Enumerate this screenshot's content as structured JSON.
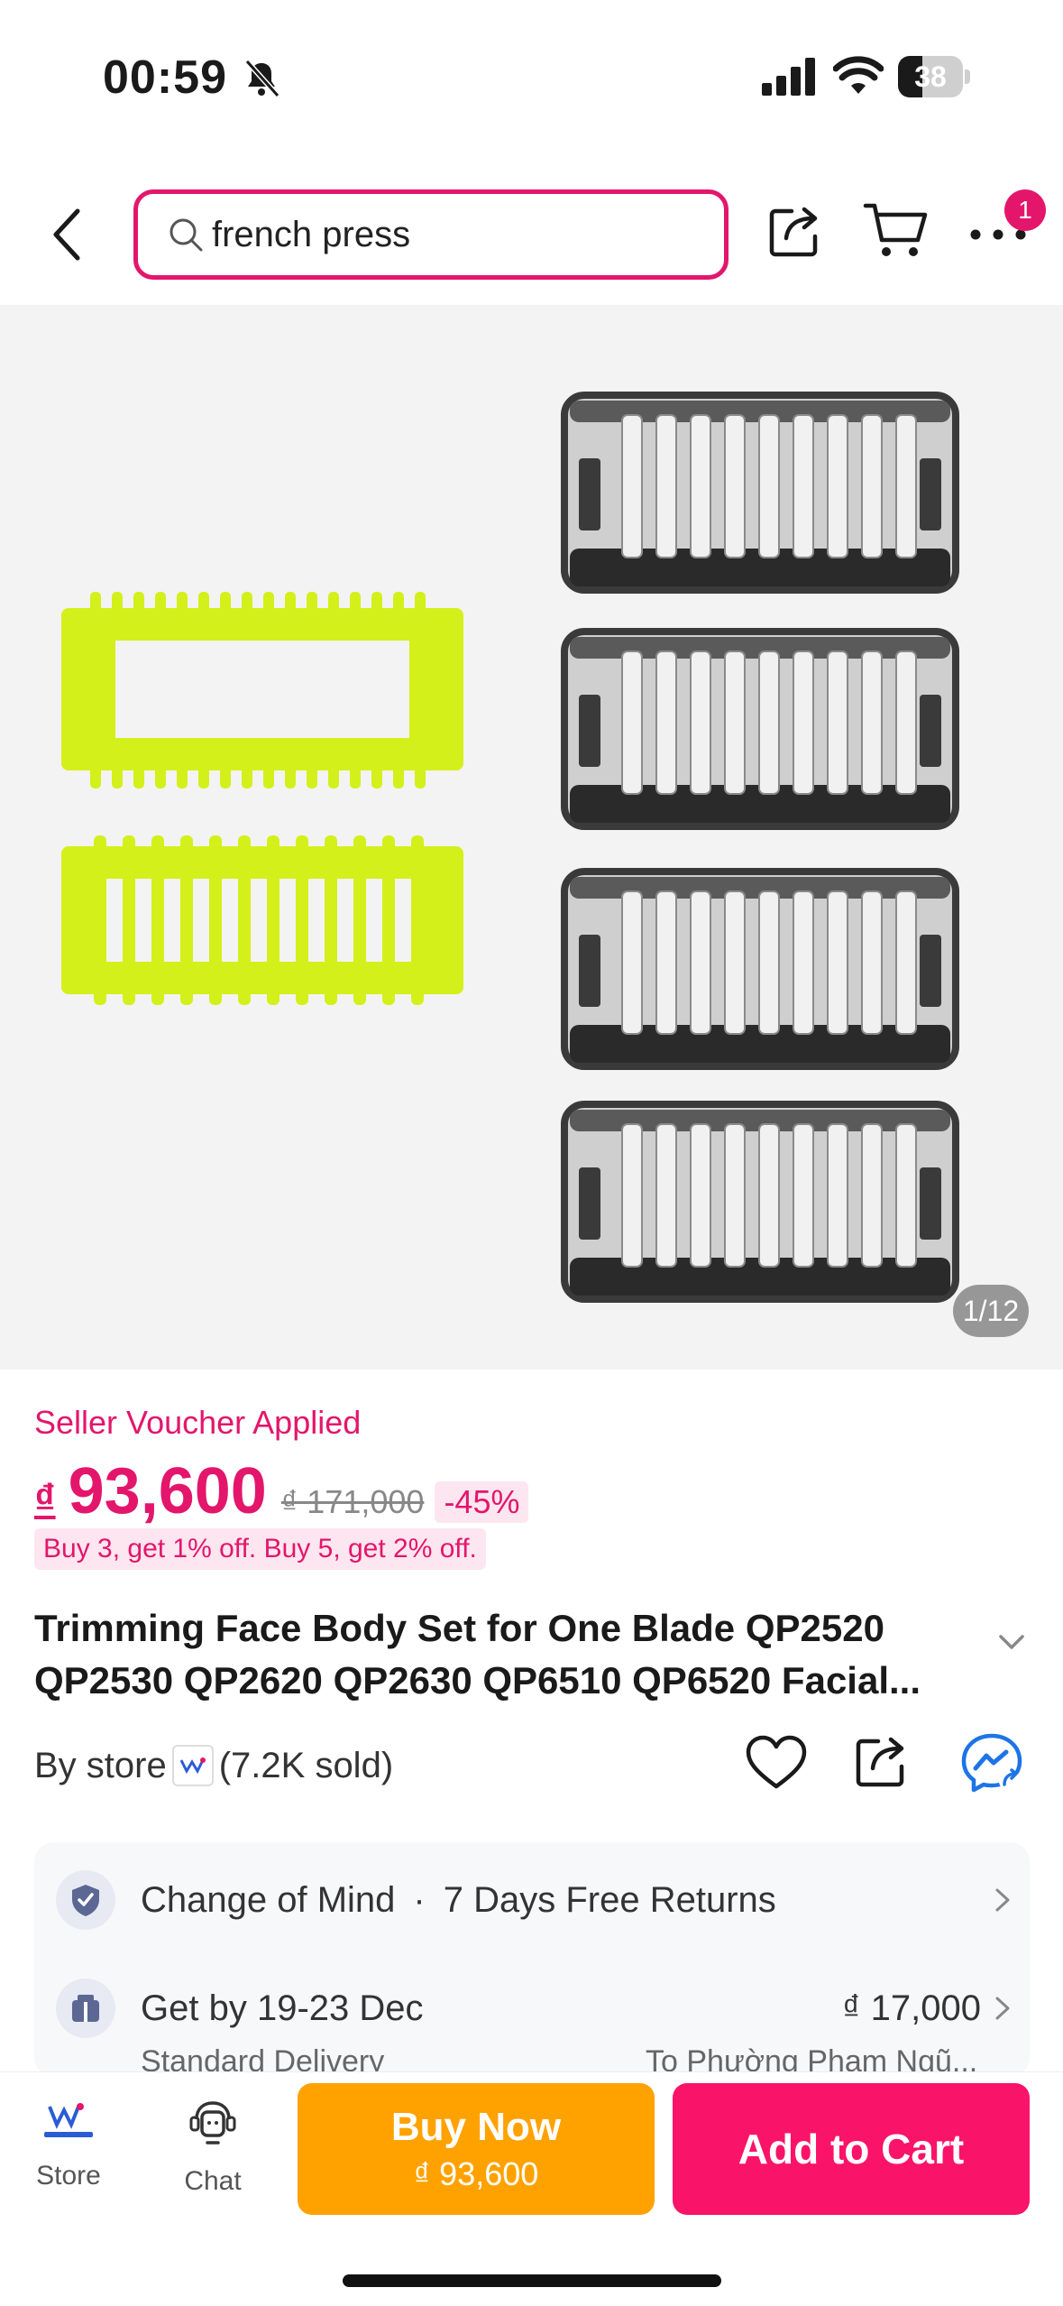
{
  "status_bar": {
    "time": "00:59",
    "battery_percent": 38,
    "battery_label": "38"
  },
  "nav": {
    "search_value": "french press",
    "more_badge": "1"
  },
  "gallery": {
    "page_indicator": "1/12"
  },
  "product": {
    "voucher_label": "Seller Voucher Applied",
    "currency": "₫",
    "price": "93,600",
    "old_price": "₫ 171,000",
    "discount": "-45%",
    "promo": "Buy 3, get 1% off. Buy 5, get 2% off.",
    "title": "Trimming Face Body Set for One Blade QP2520 QP2530 QP2620 QP2630 QP6510 QP6520 Facial...",
    "store_prefix": "By store",
    "sold": "(7.2K sold)"
  },
  "info": {
    "returns_title": "Change of Mind",
    "returns_sep": "·",
    "returns_detail": "7 Days Free Returns",
    "delivery_title": "Get by 19-23 Dec",
    "delivery_fee": "₫ 17,000",
    "delivery_method": "Standard Delivery",
    "delivery_destination": "To Phường Phạm Ngũ..."
  },
  "bottom_bar": {
    "store_label": "Store",
    "chat_label": "Chat",
    "buy_now_label": "Buy Now",
    "buy_now_price": "₫ 93,600",
    "add_to_cart_label": "Add to Cart"
  },
  "colors": {
    "brand_pink": "#e3166c",
    "buy_now_orange": "#ffa200",
    "add_to_cart_pink": "#fa1469",
    "product_lime": "#d4f01a"
  }
}
